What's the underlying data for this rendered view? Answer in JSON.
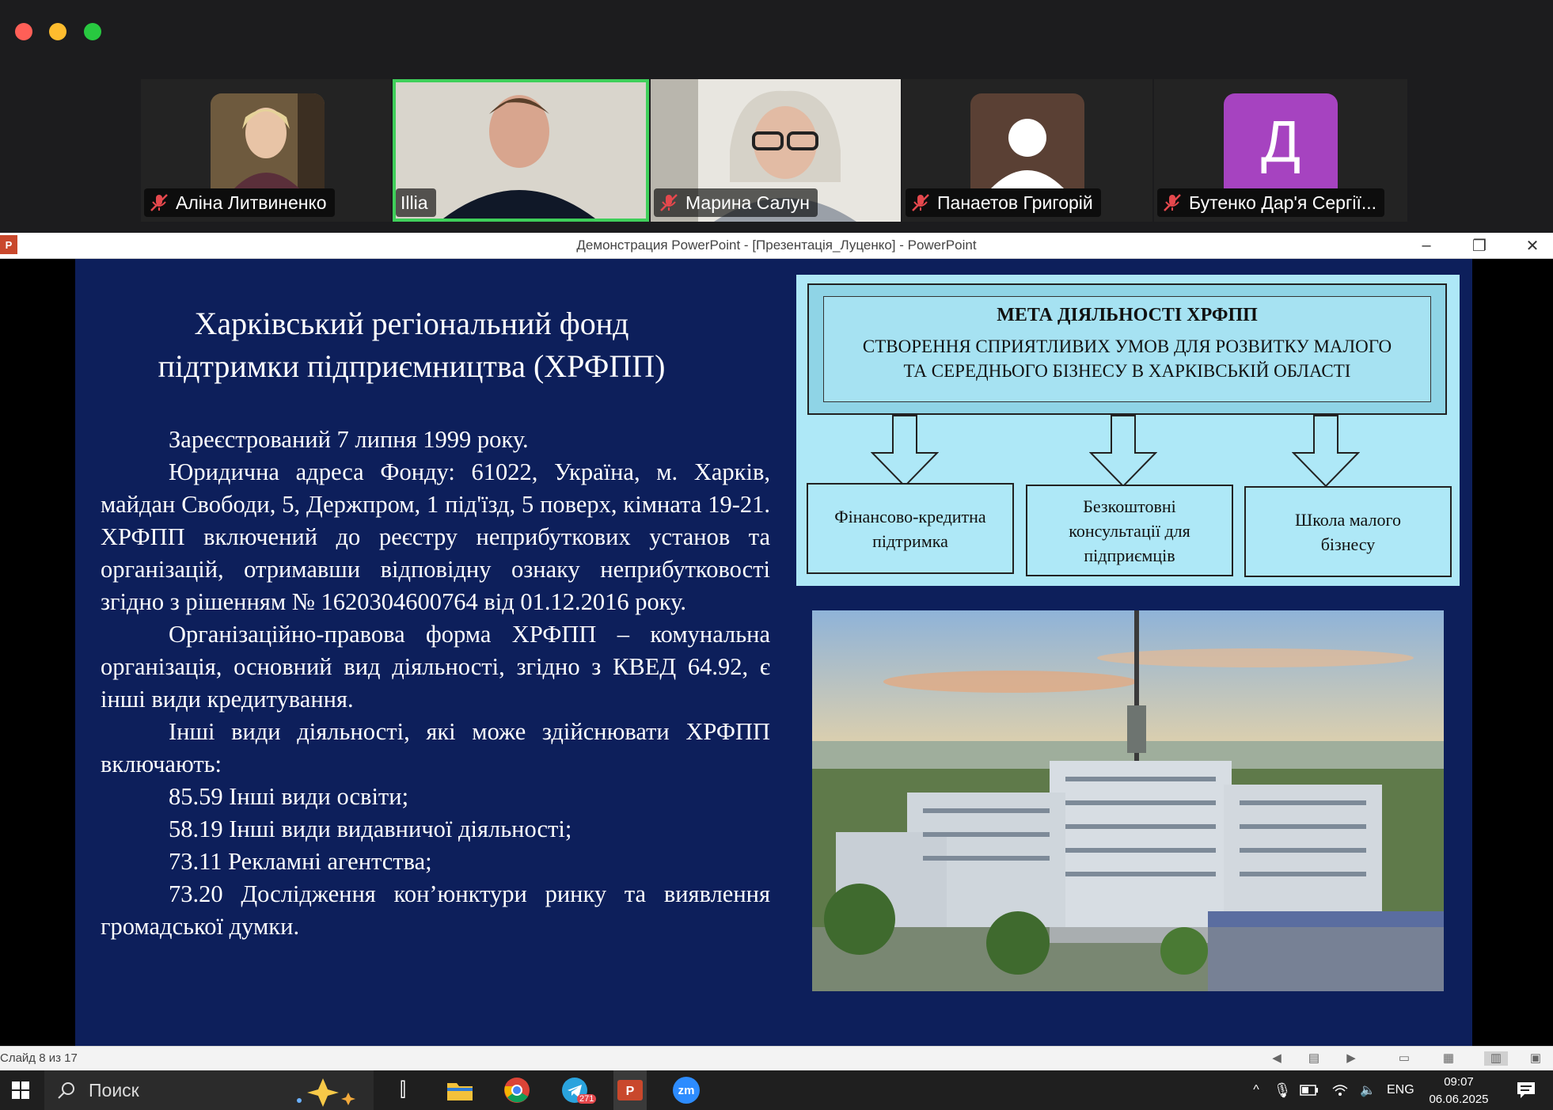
{
  "participants": [
    {
      "name": "Аліна Литвиненко",
      "muted": true
    },
    {
      "name": "Illia",
      "muted": false,
      "active": true
    },
    {
      "name": "Марина Салун",
      "muted": true
    },
    {
      "name": "Панаетов Григорій",
      "muted": true
    },
    {
      "name": "Бутенко Дар'я Сергії...",
      "muted": true,
      "initial": "Д"
    }
  ],
  "window": {
    "title": "Демонстрация PowerPoint - [Презентація_Луценко] - PowerPoint",
    "app_badge": "P"
  },
  "slide": {
    "title_line1": "Харківський регіональний фонд",
    "title_line2": "підтримки підприємництва (ХРФПП)",
    "paragraphs": [
      "Зареєстрований 7 липня 1999 року.",
      "Юридична адреса Фонду: 61022, Україна, м. Харків, майдан Свободи, 5, Держпром, 1 під'їзд, 5 поверх, кімната 19-21. ХРФПП включений до реєстру неприбуткових установ та організацій, отримавши відповідну ознаку неприбутковості згідно з рішенням № 1620304600764 від 01.12.2016 року.",
      "Організаційно-правова форма ХРФПП – комунальна організація, основний вид діяльності, згідно з КВЕД 64.92, є інші види кредитування.",
      "Інші види діяльності, які може здійснювати ХРФПП включають:",
      "85.59 Інші види освіти;",
      "58.19 Інші види видавничої діяльності;",
      "73.11 Рекламні агентства;",
      "73.20 Дослідження кон’юнктури ринку та виявлення громадської думки."
    ],
    "diagram": {
      "heading": "МЕТА ДІЯЛЬНОСТІ ХРФПП",
      "goal_line1": "СТВОРЕННЯ СПРИЯТЛИВИХ УМОВ ДЛЯ РОЗВИТКУ МАЛОГО",
      "goal_line2": "ТА СЕРЕДНЬОГО БІЗНЕСУ В ХАРКІВСЬКІЙ ОБЛАСТІ",
      "boxes": [
        {
          "line1": "Фінансово-кредитна",
          "line2": "підтримка",
          "line3": ""
        },
        {
          "line1": "Безкоштовні",
          "line2": "консультації для",
          "line3": "підприємців"
        },
        {
          "line1": "Школа малого",
          "line2": "бізнесу",
          "line3": ""
        }
      ]
    }
  },
  "status": {
    "slide_counter": "Слайд 8 из 17"
  },
  "taskbar": {
    "search_placeholder": "Поиск",
    "telegram_badge": "271",
    "zoom_label": "zm",
    "language": "ENG",
    "time": "09:07",
    "date": "06.06.2025"
  }
}
